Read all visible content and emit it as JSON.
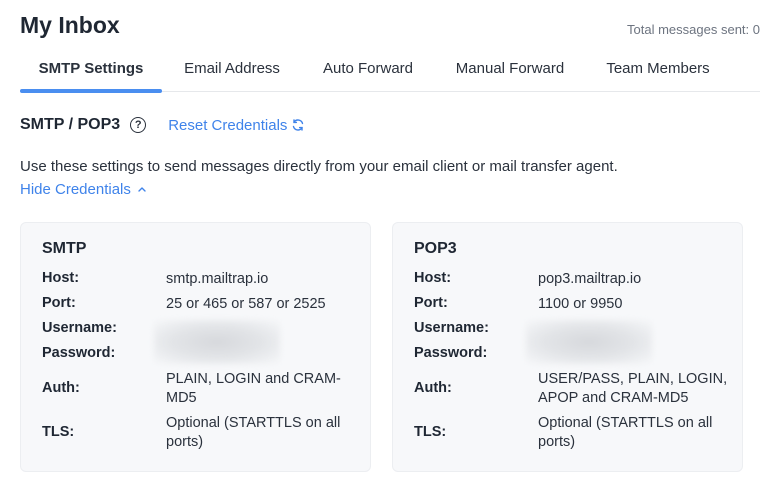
{
  "header": {
    "title": "My Inbox",
    "total_messages": "Total messages sent: 0"
  },
  "tabs": [
    {
      "label": "SMTP Settings",
      "active": true
    },
    {
      "label": "Email Address",
      "active": false
    },
    {
      "label": "Auto Forward",
      "active": false
    },
    {
      "label": "Manual Forward",
      "active": false
    },
    {
      "label": "Team Members",
      "active": false
    }
  ],
  "section": {
    "title": "SMTP / POP3",
    "reset_label": "Reset Credentials",
    "description": "Use these settings to send messages directly from your email client or mail transfer agent.",
    "hide_label": "Hide Credentials"
  },
  "smtp": {
    "title": "SMTP",
    "host_label": "Host:",
    "host": "smtp.mailtrap.io",
    "port_label": "Port:",
    "port": "25 or 465 or 587 or 2525",
    "username_label": "Username:",
    "password_label": "Password:",
    "auth_label": "Auth:",
    "auth": "PLAIN, LOGIN and CRAM-MD5",
    "tls_label": "TLS:",
    "tls": "Optional (STARTTLS on all ports)"
  },
  "pop3": {
    "title": "POP3",
    "host_label": "Host:",
    "host": "pop3.mailtrap.io",
    "port_label": "Port:",
    "port": "1100 or 9950",
    "username_label": "Username:",
    "password_label": "Password:",
    "auth_label": "Auth:",
    "auth": "USER/PASS, PLAIN, LOGIN, APOP and CRAM-MD5",
    "tls_label": "TLS:",
    "tls": "Optional (STARTTLS on all ports)"
  },
  "colors": {
    "accent": "#4a8ef0",
    "link": "#3f83ea",
    "card_bg": "#f7f8fa"
  }
}
